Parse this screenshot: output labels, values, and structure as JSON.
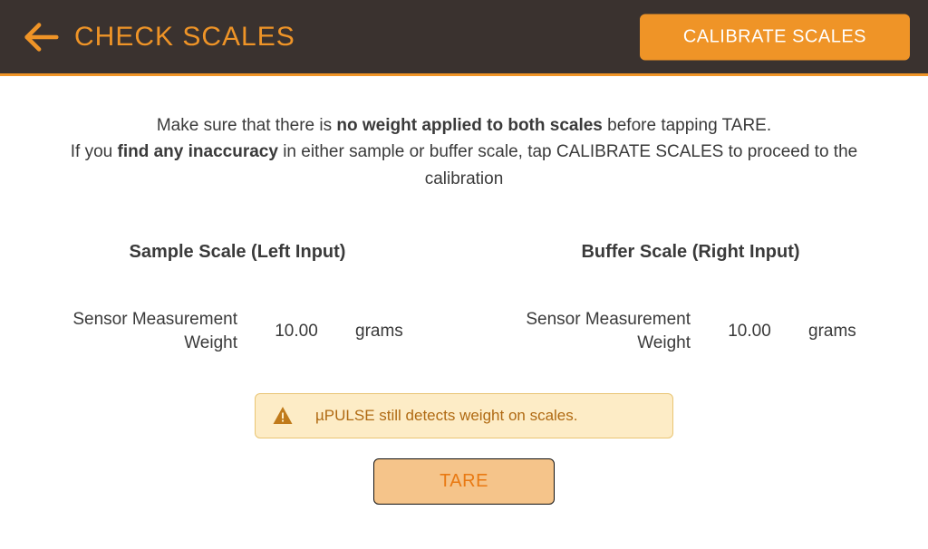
{
  "header": {
    "title": "CHECK SCALES",
    "calibrate_label": "CALIBRATE SCALES"
  },
  "instructions": {
    "line1_pre": "Make sure that there is ",
    "line1_bold": "no weight applied to both scales",
    "line1_post": " before tapping TARE.",
    "line2_pre": "If you ",
    "line2_bold": "find any inaccuracy",
    "line2_post": " in either sample or buffer scale, tap CALIBRATE SCALES to proceed to the calibration"
  },
  "scales": {
    "sample": {
      "title": "Sample Scale (Left Input)",
      "measurement_label": "Sensor Measurement Weight",
      "value": "10.00",
      "unit": "grams"
    },
    "buffer": {
      "title": "Buffer Scale (Right Input)",
      "measurement_label": "Sensor Measurement Weight",
      "value": "10.00",
      "unit": "grams"
    }
  },
  "warning": {
    "text": "µPULSE still detects weight on scales."
  },
  "tare": {
    "label": "TARE"
  },
  "colors": {
    "accent": "#ef9427",
    "topbar_bg": "#3a322f",
    "warning_bg": "#fdecc6",
    "warning_border": "#e9c574",
    "warning_text": "#b06a13",
    "tare_bg": "#f5c48a",
    "tare_text": "#e97912"
  }
}
